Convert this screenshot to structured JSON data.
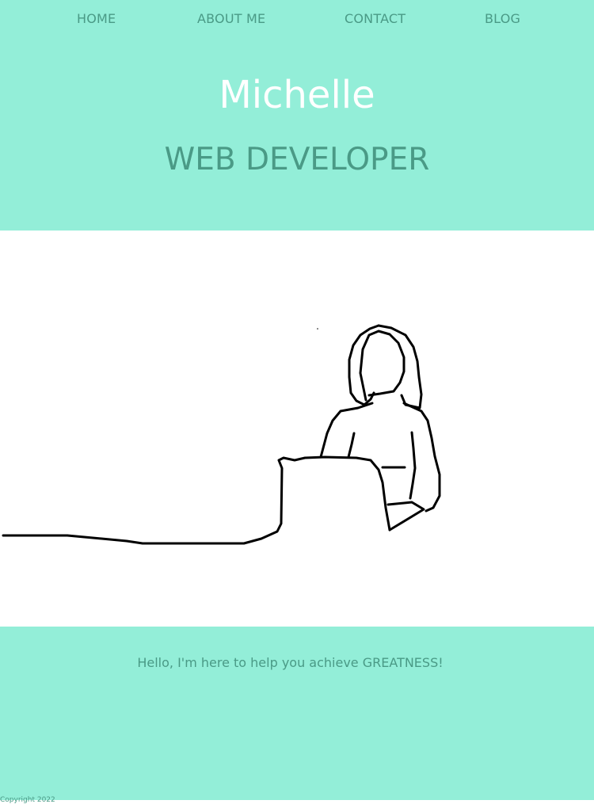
{
  "nav": {
    "items": [
      {
        "label": "HOME"
      },
      {
        "label": "ABOUT ME"
      },
      {
        "label": "CONTACT"
      },
      {
        "label": "BLOG"
      }
    ]
  },
  "header": {
    "title": "Michelle",
    "subtitle": "WEB DEVELOPER"
  },
  "footer": {
    "tagline": "Hello, I'm here to help you achieve GREATNESS!",
    "copyright": "Copyright 2022"
  },
  "colors": {
    "background": "#93eed8",
    "accent_text": "#4a9a86",
    "title_text": "#ffffff"
  }
}
